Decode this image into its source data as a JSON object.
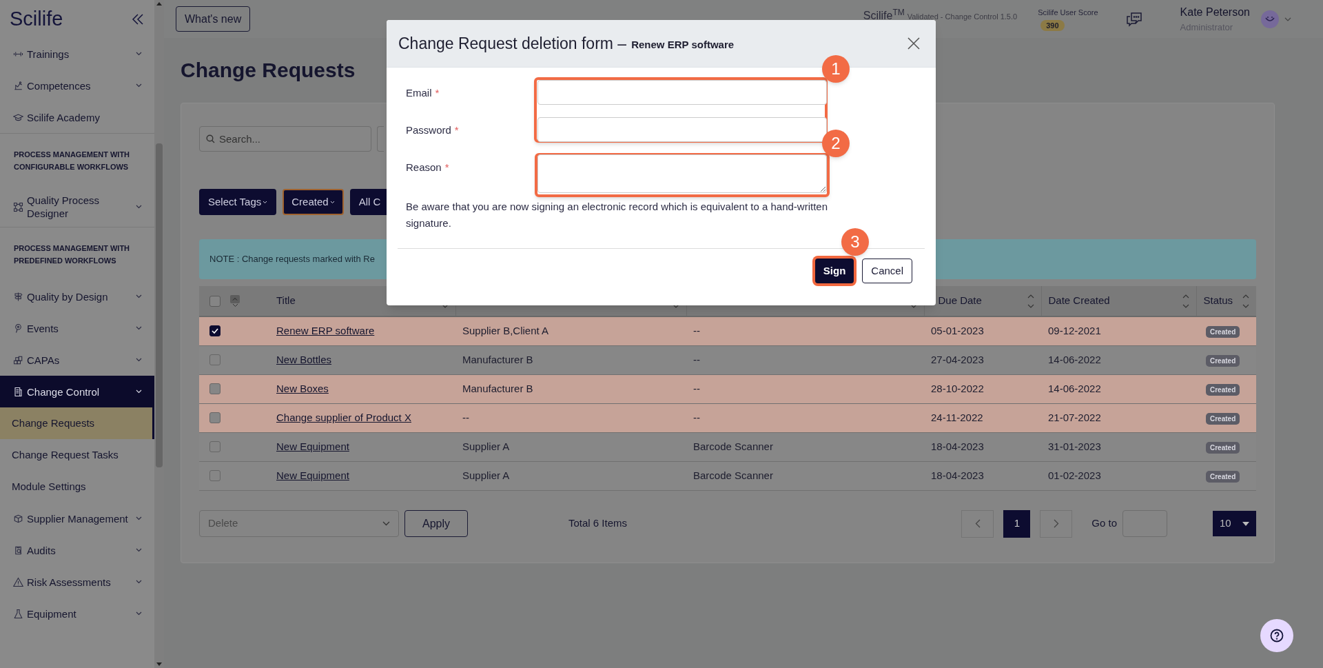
{
  "sidebar": {
    "logo": "Scilife",
    "items": [
      {
        "kind": "item",
        "label": "Trainings",
        "expandable": true,
        "selected": false
      },
      {
        "kind": "item",
        "label": "Competences",
        "expandable": true,
        "selected": false
      },
      {
        "kind": "item",
        "label": "Scilife Academy",
        "expandable": false,
        "selected": false
      },
      {
        "kind": "section",
        "label": "PROCESS MANAGEMENT WITH CONFIGURABLE WORKFLOWS"
      },
      {
        "kind": "item",
        "label": "Quality Process Designer",
        "expandable": true,
        "selected": false
      },
      {
        "kind": "section",
        "label": "PROCESS MANAGEMENT WITH PREDEFINED WORKFLOWS"
      },
      {
        "kind": "item",
        "label": "Quality by Design",
        "expandable": true,
        "selected": false
      },
      {
        "kind": "item",
        "label": "Events",
        "expandable": true,
        "selected": false
      },
      {
        "kind": "item",
        "label": "CAPAs",
        "expandable": true,
        "selected": false
      },
      {
        "kind": "item",
        "label": "Change Control",
        "expandable": true,
        "selected": true
      },
      {
        "kind": "subitem",
        "label": "Change Requests",
        "selected": true
      },
      {
        "kind": "subitem",
        "label": "Change Request Tasks",
        "selected": false
      },
      {
        "kind": "subitem",
        "label": "Module Settings",
        "selected": false
      },
      {
        "kind": "item",
        "label": "Supplier Management",
        "expandable": true,
        "selected": false
      },
      {
        "kind": "item",
        "label": "Audits",
        "expandable": true,
        "selected": false
      },
      {
        "kind": "item",
        "label": "Risk Assessments",
        "expandable": true,
        "selected": false
      },
      {
        "kind": "item",
        "label": "Equipment",
        "expandable": true,
        "selected": false
      }
    ]
  },
  "header": {
    "whats_new": "What's new",
    "product": "Scilife$^{TM}$",
    "product_note": "Validated - Change Control 1.5.0",
    "score_label": "Scilife User Score",
    "score": "390",
    "user_name": "Kate Peterson",
    "user_role": "Administrator"
  },
  "page_title": "Change Requests",
  "search": {
    "placeholder": "Search..."
  },
  "filters": [
    {
      "label": "Select Tags",
      "selected": false
    },
    {
      "label": "Created",
      "selected": true
    },
    {
      "label": "All C",
      "selected": false
    }
  ],
  "note": "NOTE : Change requests marked with Re",
  "table": {
    "select_all": false,
    "columns": [
      {
        "label": "Title"
      },
      {},
      {},
      {
        "label": "Due Date"
      },
      {
        "label": "Date Created"
      },
      {
        "label": "Status"
      }
    ],
    "rows": [
      {
        "checked": true,
        "highlighted": true,
        "title": "Renew ERP software",
        "column_2": "Supplier B,Client A",
        "column_3": "--",
        "due_date": "05-01-2023",
        "date_created": "09-12-2021",
        "status": "Created"
      },
      {
        "checked": false,
        "highlighted": false,
        "title": "New Bottles",
        "column_2": "Manufacturer B",
        "column_3": "--",
        "due_date": "27-04-2023",
        "date_created": "14-06-2022",
        "status": "Created"
      },
      {
        "checked": false,
        "highlighted": true,
        "title": "New Boxes",
        "column_2": "Manufacturer B",
        "column_3": "--",
        "due_date": "28-10-2022",
        "date_created": "14-06-2022",
        "status": "Created"
      },
      {
        "checked": false,
        "highlighted": true,
        "title": "Change supplier of Product X",
        "column_2": "--",
        "column_3": "--",
        "due_date": "24-11-2022",
        "date_created": "21-07-2022",
        "status": "Created"
      },
      {
        "checked": false,
        "highlighted": false,
        "title": "New Equipment",
        "column_2": "Supplier A",
        "column_3": "Barcode Scanner",
        "due_date": "18-04-2023",
        "date_created": "31-01-2023",
        "status": "Created"
      },
      {
        "checked": false,
        "highlighted": false,
        "title": "New Equipment",
        "column_2": "Supplier A",
        "column_3": "Barcode Scanner",
        "due_date": "18-04-2023",
        "date_created": "01-02-2023",
        "status": "Created"
      }
    ]
  },
  "footer": {
    "bulk_action": "Delete",
    "apply": "Apply",
    "total": "Total 6 Items",
    "pages": [
      {
        "label": "1",
        "selected": true
      }
    ],
    "go_to": "Go to",
    "page_size": "10"
  },
  "modal": {
    "title": "Change Request deletion form –",
    "subtitle": "Renew ERP software",
    "fields": [
      {
        "label": "Email",
        "kind": "input",
        "required_mark": "*"
      },
      {
        "label": "Password",
        "kind": "password",
        "required_mark": "*"
      },
      {
        "label": "Reason",
        "kind": "textarea",
        "required_mark": "*"
      }
    ],
    "notice": "Be aware that you are now signing an electronic record which is equivalent to a hand-written signature.",
    "buttons": [
      {
        "label": "Sign",
        "kind": "primary"
      },
      {
        "label": "Cancel",
        "kind": "secondary"
      }
    ],
    "annotations": [
      "1",
      "2",
      "3"
    ]
  }
}
